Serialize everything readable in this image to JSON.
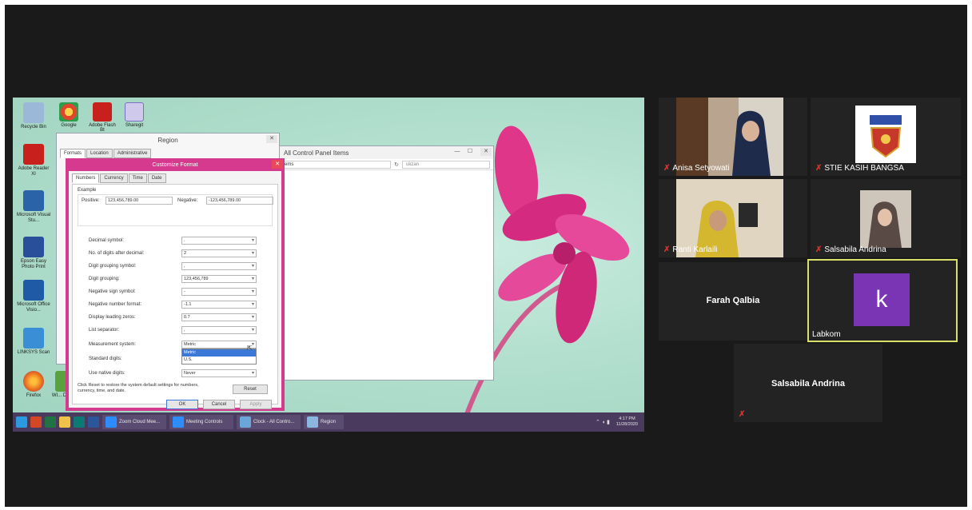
{
  "screen": {
    "desktop_icons": [
      {
        "label": "Recycle Bin",
        "color": "#4a7ab8"
      },
      {
        "label": "Adobe Reader XI",
        "color": "#c8201c"
      },
      {
        "label": "Microsoft Visual Stu...",
        "color": "#2a63a8"
      },
      {
        "label": "Epson Easy Photo Print",
        "color": "#2a4f9a"
      },
      {
        "label": "Microsoft Office Visio...",
        "color": "#1f5aa6"
      },
      {
        "label": "LINKSYS Scan",
        "color": "#3a8ed6"
      },
      {
        "label": "Firefox",
        "color": "#e66a1e"
      },
      {
        "label": "WI... Down...",
        "color": "#5aa23c"
      }
    ],
    "top_icons": [
      {
        "label": "Google",
        "color": "#e0452d"
      },
      {
        "label": "Adobe Flash Bt",
        "color": "#c8201c"
      },
      {
        "label": "Sharegit",
        "color": "#7a6fc1"
      }
    ],
    "region_window": {
      "title": "Region",
      "tabs": [
        "Formats",
        "Location",
        "Administrative"
      ]
    },
    "control_panel": {
      "title": "All Control Panel Items",
      "breadcrumb": "ems",
      "search": "ukzan"
    },
    "customize": {
      "title": "Customize Format",
      "close": "✕",
      "tabs": [
        "Numbers",
        "Currency",
        "Time",
        "Date"
      ],
      "example_label": "Example",
      "positive_label": "Positive:",
      "positive_value": "123,456,789.00",
      "negative_label": "Negative:",
      "negative_value": "-123,456,789.00",
      "fields": [
        {
          "label": "Decimal symbol:",
          "value": "."
        },
        {
          "label": "No. of digits after decimal:",
          "value": "2"
        },
        {
          "label": "Digit grouping symbol:",
          "value": ","
        },
        {
          "label": "Digit grouping:",
          "value": "123,456,789"
        },
        {
          "label": "Negative sign symbol:",
          "value": "-"
        },
        {
          "label": "Negative number format:",
          "value": "-1.1"
        },
        {
          "label": "Display leading zeros:",
          "value": "0.7"
        },
        {
          "label": "List separator:",
          "value": ","
        },
        {
          "label": "Measurement system:",
          "value": "Metric"
        }
      ],
      "dropdown_options": [
        "Metric",
        "U.S."
      ],
      "standard_digits_label": "Standard digits:",
      "native_digits_label": "Use native digits:",
      "native_digits_value": "Never",
      "reset_text": "Click Reset to restore the system default settings for numbers, currency, time, and date.",
      "reset_label": "Reset",
      "ok_label": "OK",
      "cancel_label": "Cancel",
      "apply_label": "Apply"
    },
    "taskbar": {
      "tasks": [
        "Zoom Cloud Mee...",
        "Meeting Controls",
        "Clock - All Contro...",
        "Region"
      ],
      "time": "4:17 PM",
      "date": "11/28/2020"
    }
  },
  "participants": [
    {
      "name": "Anisa Setyowati",
      "muted": true
    },
    {
      "name": "STIE KASIH BANGSA",
      "muted": true
    },
    {
      "name": "Ranti Karlaili",
      "muted": true
    },
    {
      "name": "Salsabila Andrina",
      "muted": true
    },
    {
      "name": "Farah Qalbia"
    },
    {
      "name": "Labkom",
      "avatar_letter": "k"
    },
    {
      "name": "Salsabila Andrina",
      "muted": true
    }
  ],
  "colors": {
    "active_speaker": "#d8e06a",
    "avatar": "#7a35b5",
    "dialog_accent": "#d63a8e",
    "mic_muted": "#e0302a"
  }
}
